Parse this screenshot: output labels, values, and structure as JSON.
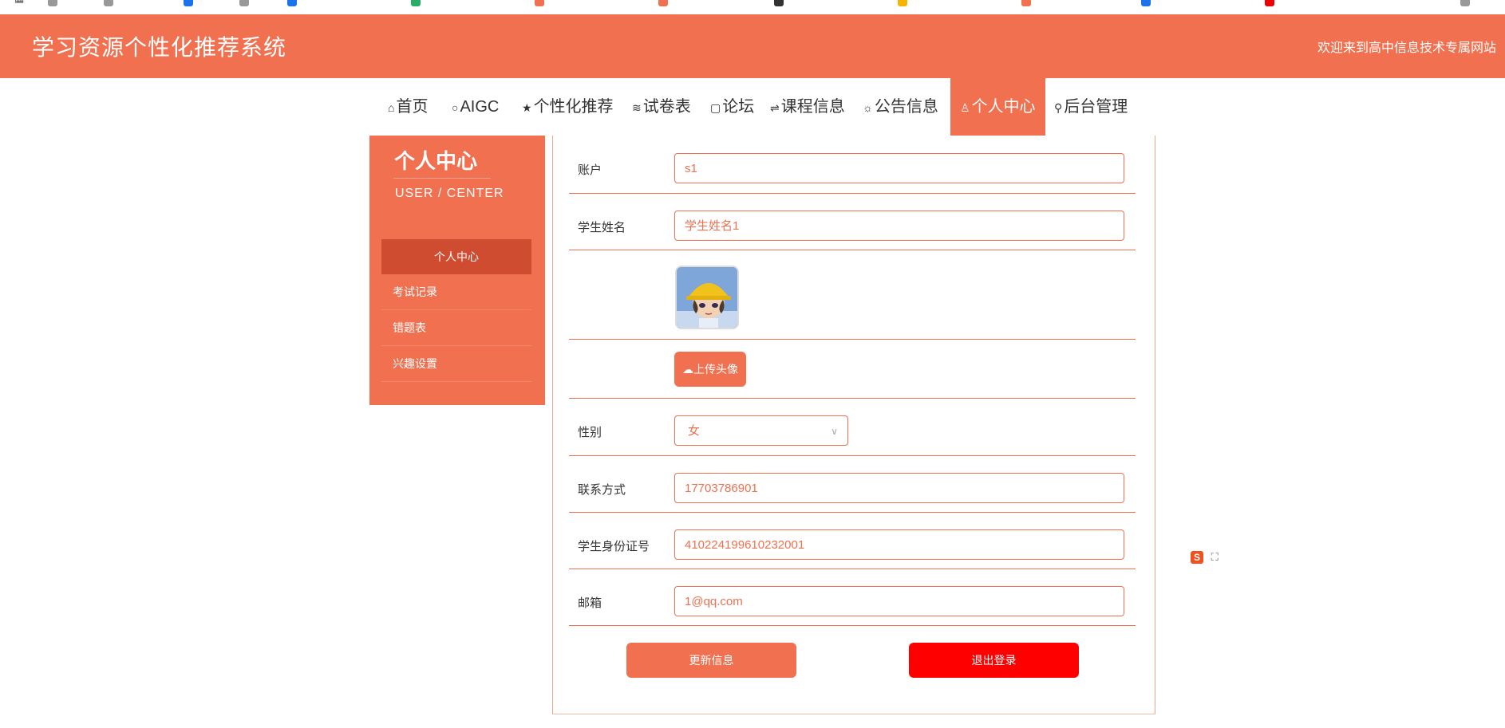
{
  "header": {
    "title": "学习资源个性化推荐系统",
    "welcome": "欢迎来到高中信息技术专属网站"
  },
  "nav": [
    {
      "icon": "⌂",
      "label": "首页"
    },
    {
      "icon": "○",
      "label": "AIGC"
    },
    {
      "icon": "★",
      "label": "个性化推荐"
    },
    {
      "icon": "≋",
      "label": "试卷表"
    },
    {
      "icon": "▢",
      "label": "论坛"
    },
    {
      "icon": "⇌",
      "label": "课程信息"
    },
    {
      "icon": "☼",
      "label": "公告信息"
    },
    {
      "icon": "♙",
      "label": "个人中心"
    },
    {
      "icon": "⚲",
      "label": "后台管理"
    }
  ],
  "sidebar": {
    "title": "个人中心",
    "subtitle": "USER / CENTER",
    "items": [
      {
        "label": "个人中心"
      },
      {
        "label": "考试记录"
      },
      {
        "label": "错题表"
      },
      {
        "label": "兴趣设置"
      }
    ]
  },
  "form": {
    "account_label": "账户",
    "account_value": "s1",
    "name_label": "学生姓名",
    "name_value": "学生姓名1",
    "upload_label": "上传头像",
    "gender_label": "性别",
    "gender_value": "女",
    "phone_label": "联系方式",
    "phone_value": "17703786901",
    "id_label": "学生身份证号",
    "id_value": "410224199610232001",
    "email_label": "邮箱",
    "email_value": "1@qq.com"
  },
  "buttons": {
    "update": "更新信息",
    "logout": "退出登录"
  },
  "colors": {
    "accent": "#f07050",
    "accent_dark": "#d04c30",
    "logout": "#ff0000"
  }
}
